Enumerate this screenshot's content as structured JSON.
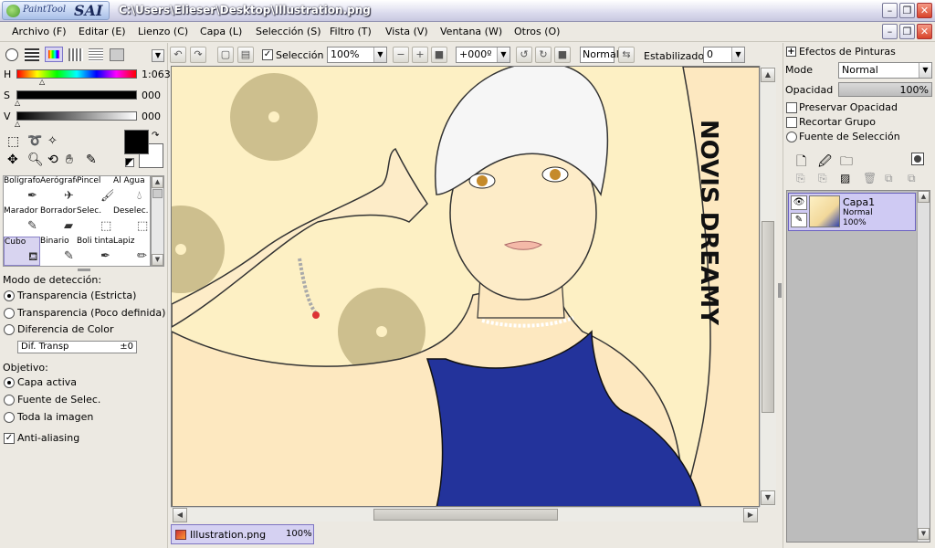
{
  "app": {
    "logo_small": "PaintTool",
    "logo_big": "SAI",
    "title": "C:\\Users\\Elieser\\Desktop\\Illustration.png"
  },
  "menu": [
    "Archivo (F)",
    "Editar (E)",
    "Lienzo (C)",
    "Capa (L)",
    "Selección (S)",
    "Filtro (T)",
    "Vista (V)",
    "Ventana (W)",
    "Otros (O)"
  ],
  "toolbar": {
    "selection_label": "Selección",
    "zoom": "100%",
    "rotation": "+000º",
    "blend": "Normal",
    "stabilizer_label": "Estabilizador",
    "stabilizer_value": "0"
  },
  "color": {
    "h_label": "H",
    "s_label": "S",
    "v_label": "V",
    "h_value": "1:063",
    "s_value": "000",
    "v_value": "000",
    "primary": "#000000",
    "secondary": "#ffffff"
  },
  "tools": [
    {
      "label": "Bolígrafo",
      "icon": "pen-icon"
    },
    {
      "label": "Aerógrafo",
      "icon": "airbrush-icon"
    },
    {
      "label": "Pincel",
      "icon": "brush-icon"
    },
    {
      "label": "Al Agua",
      "icon": "watercolor-icon"
    },
    {
      "label": "Marador",
      "icon": "marker-icon"
    },
    {
      "label": "Borrador",
      "icon": "eraser-icon"
    },
    {
      "label": "Selec.",
      "icon": "select-brush-icon"
    },
    {
      "label": "Deselec.",
      "icon": "deselect-brush-icon"
    },
    {
      "label": "Cubo",
      "icon": "bucket-icon"
    },
    {
      "label": "Binario",
      "icon": "binary-pen-icon"
    },
    {
      "label": "Boli tinta",
      "icon": "ink-pen-icon"
    },
    {
      "label": "Lapiz",
      "icon": "pencil-icon"
    }
  ],
  "fill": {
    "detection_title": "Modo de detección:",
    "detection_options": [
      "Transparencia (Estricta)",
      "Transparencia (Poco definida)",
      "Diferencia de Color"
    ],
    "detection_selected": 0,
    "dif_label": "Dif. Transp",
    "dif_value": "±0",
    "target_title": "Objetivo:",
    "target_options": [
      "Capa activa",
      "Fuente de Selec.",
      "Toda la imagen"
    ],
    "target_selected": 0,
    "antialias_label": "Anti-aliasing",
    "antialias_checked": true
  },
  "canvas": {
    "artwork_text": "NOVIS DREAMY",
    "doc_tab_name": "Illustration.png",
    "doc_tab_zoom": "100%"
  },
  "right": {
    "effects_title": "Efectos de Pinturas",
    "mode_label": "Mode",
    "mode_value": "Normal",
    "opacity_label": "Opacidad",
    "opacity_value": "100%",
    "preserve_opacity": "Preservar Opacidad",
    "clip_group": "Recortar Grupo",
    "selection_source": "Fuente de Selección"
  },
  "layers": [
    {
      "name": "Capa1",
      "mode": "Normal",
      "opacity": "100%"
    }
  ]
}
